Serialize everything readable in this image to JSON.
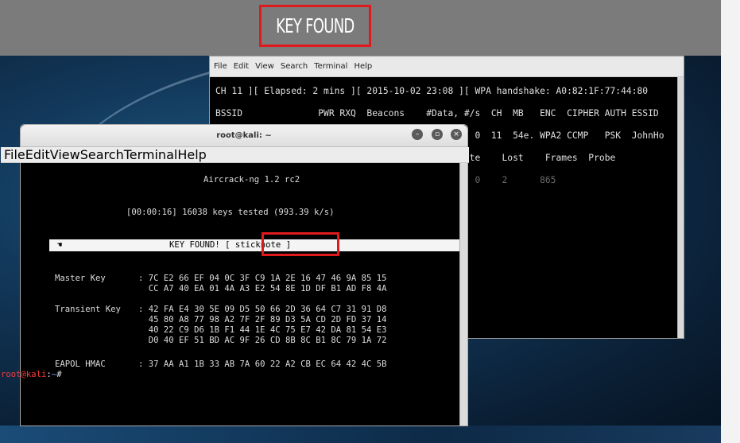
{
  "banner": {
    "text": "KEY FOUND"
  },
  "back_terminal": {
    "menu": [
      "File",
      "Edit",
      "View",
      "Search",
      "Terminal",
      "Help"
    ],
    "lines": [
      "CH 11 ][ Elapsed: 2 mins ][ 2015-10-02 23:08 ][ WPA handshake: A0:82:1F:77:44:80",
      "BSSID              PWR RXQ  Beacons    #Data, #/s  CH  MB   ENC  CIPHER AUTH ESSID",
      "                                                0  11  54e. WPA2 CCMP   PSK  JohnHo",
      "                                               te    Lost    Frames  Probe",
      "                   74:E2:F5:8F:5D:6E  -40    e- 0    2      865"
    ]
  },
  "front_terminal": {
    "title": "root@kali: ~",
    "menu": [
      "File",
      "Edit",
      "View",
      "Search",
      "Terminal",
      "Help"
    ],
    "header": "Aircrack-ng 1.2 rc2",
    "progress": "[00:00:16] 16038 keys tested (993.39 k/s)",
    "key_found_label": "KEY FOUND! [ sticknote ]",
    "master_key_label": "Master Key",
    "master_key": [
      ": 7C E2 66 EF 04 0C 3F C9 1A 2E 16 47 46 9A 85 15",
      "  CC A7 40 EA 01 4A A3 E2 54 8E 1D DF B1 AD F8 4A"
    ],
    "transient_key_label": "Transient Key",
    "transient_key": [
      ": 42 FA E4 30 5E 09 D5 50 66 2D 36 64 C7 31 91 D8",
      "  45 80 A8 77 98 A2 7F 2F 89 D3 5A CD 2D FD 37 14",
      "  40 22 C9 D6 1B F1 44 1E 4C 75 E7 42 DA 81 54 E3",
      "  D0 40 EF 51 BD AC 9F 26 CD 8B 8C B1 8C 79 1A 72"
    ],
    "eapol_label": "EAPOL HMAC",
    "eapol": ": 37 AA A1 1B 33 AB 7A 60 22 A2 CB EC 64 42 4C 5B",
    "prompt_user": "root@kali",
    "prompt_sep": ":",
    "prompt_path": "~",
    "prompt_symbol": "#"
  }
}
